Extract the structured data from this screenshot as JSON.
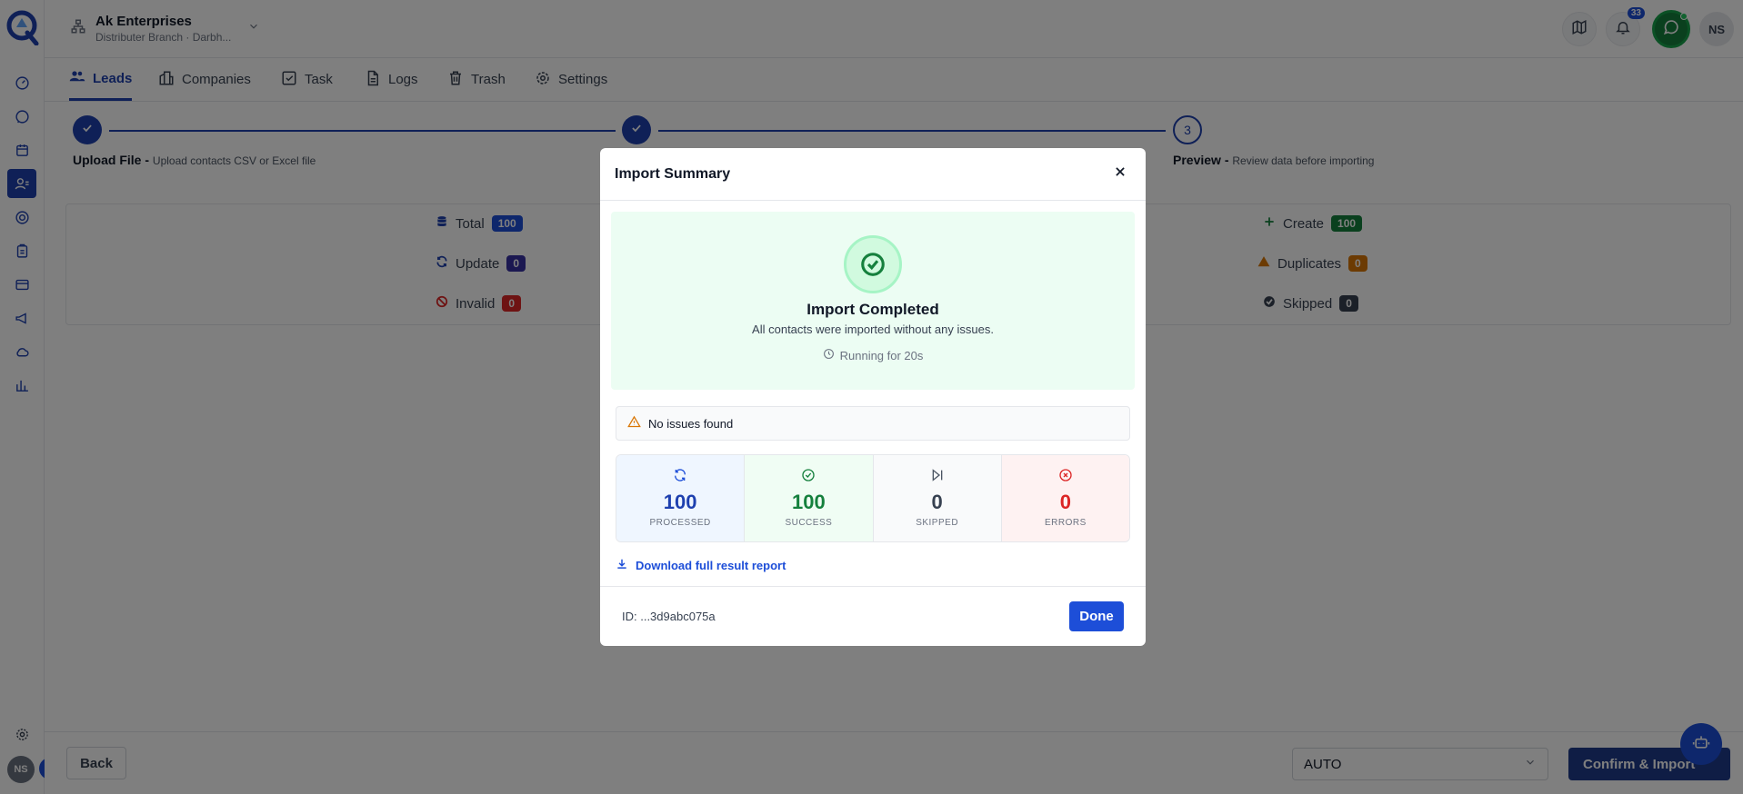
{
  "header": {
    "org_name": "Ak Enterprises",
    "org_sub": "Distributer Branch · Darbh...",
    "notification_count": "33",
    "avatar_initials": "NS"
  },
  "tabs": [
    {
      "label": "Leads",
      "icon": "users-icon",
      "active": true
    },
    {
      "label": "Companies",
      "icon": "building-icon"
    },
    {
      "label": "Task",
      "icon": "checkbox-icon"
    },
    {
      "label": "Logs",
      "icon": "document-icon"
    },
    {
      "label": "Trash",
      "icon": "trash-icon"
    },
    {
      "label": "Settings",
      "icon": "gear-icon"
    }
  ],
  "stepper": {
    "steps": [
      {
        "title": "Upload File",
        "separator": " - ",
        "desc": "Upload contacts CSV or Excel file",
        "state": "done"
      },
      {
        "title": "",
        "separator": "",
        "desc": "",
        "state": "done"
      },
      {
        "number": "3",
        "title": "Preview",
        "separator": " - ",
        "desc": "Review data before importing",
        "state": "todo"
      }
    ]
  },
  "stats": {
    "total": {
      "label": "Total",
      "value": "100"
    },
    "update": {
      "label": "Update",
      "value": "0"
    },
    "invalid": {
      "label": "Invalid",
      "value": "0"
    },
    "create": {
      "label": "Create",
      "value": "100"
    },
    "duplicates": {
      "label": "Duplicates",
      "value": "0"
    },
    "skipped": {
      "label": "Skipped",
      "value": "0"
    }
  },
  "footer": {
    "back_label": "Back",
    "mode_value": "AUTO",
    "confirm_label": "Confirm & Import"
  },
  "rail": {
    "avatar_initials": "NS"
  },
  "modal": {
    "title": "Import Summary",
    "status_title": "Import Completed",
    "status_desc": "All contacts were imported without any issues.",
    "running": "Running for 20s",
    "issues": "No issues found",
    "metrics": [
      {
        "value": "100",
        "label": "PROCESSED",
        "color": "#1e40af",
        "bg": "#eff6ff",
        "icon": "refresh-icon"
      },
      {
        "value": "100",
        "label": "SUCCESS",
        "color": "#15803d",
        "bg": "#f0fdf4",
        "icon": "check-circle-icon"
      },
      {
        "value": "0",
        "label": "SKIPPED",
        "color": "#374151",
        "bg": "#f9fafb",
        "icon": "skip-icon"
      },
      {
        "value": "0",
        "label": "ERRORS",
        "color": "#dc2626",
        "bg": "#fef2f2",
        "icon": "x-circle-icon"
      }
    ],
    "download_label": "Download full result report",
    "op_id": "ID: ...3d9abc075a",
    "done_label": "Done"
  },
  "colors": {
    "primary": "#1e40af",
    "success": "#15803d",
    "danger": "#dc2626",
    "warning": "#d97706"
  }
}
